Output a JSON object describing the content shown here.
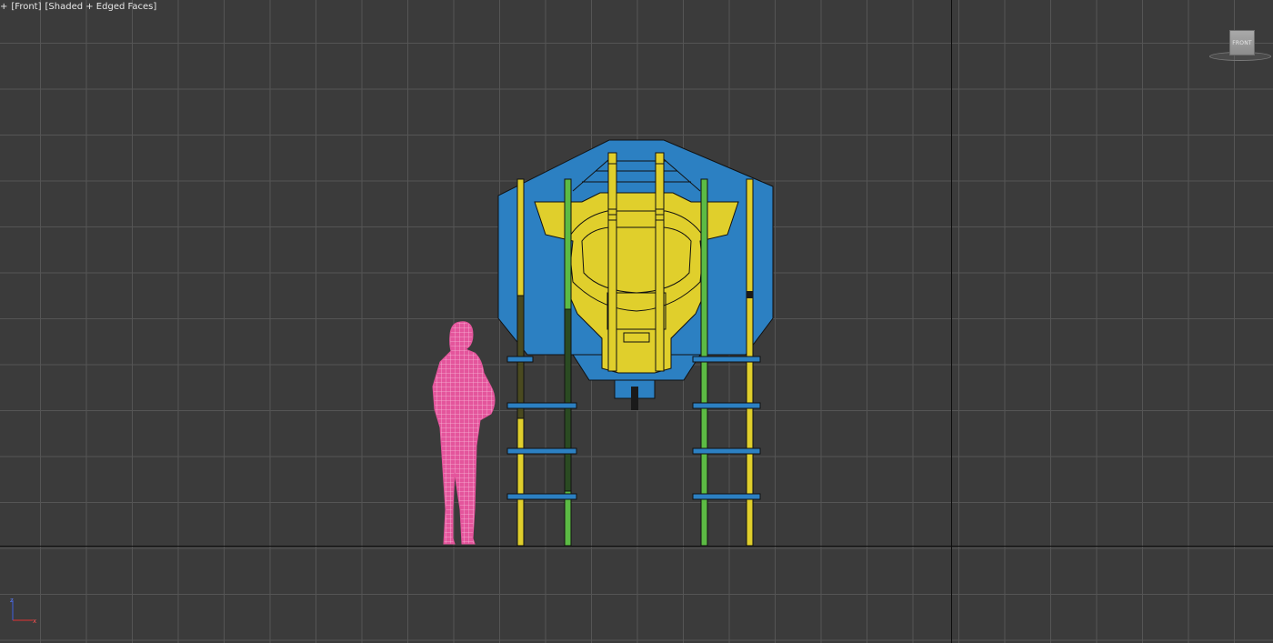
{
  "viewport": {
    "menu_label": "+",
    "view_label": "[Front]",
    "shading_label": "[Shaded + Edged Faces]"
  },
  "viewcube": {
    "face_label": "FRONT"
  },
  "axis_gizmo": {
    "x_label": "x",
    "z_label": "z"
  },
  "colors": {
    "background": "#3b3b3b",
    "grid": "#555555",
    "panel_blue": "#2c80c2",
    "head_yellow": "#e0cf2c",
    "pole_green": "#5cbb44",
    "figure_pink": "#e4559c"
  }
}
